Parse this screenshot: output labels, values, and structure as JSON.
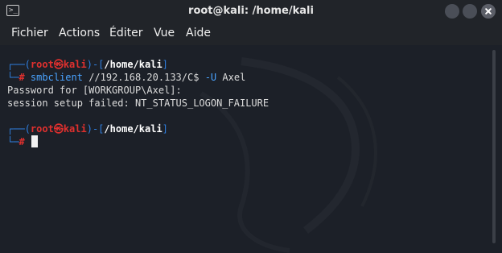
{
  "window": {
    "title": "root@kali: /home/kali",
    "app_icon_glyph": ">_"
  },
  "menu": [
    "Fichier",
    "Actions",
    "Éditer",
    "Vue",
    "Aide"
  ],
  "terminal": {
    "prompt1": {
      "box_top": "┌──(",
      "user": "root",
      "skull": "㉿",
      "host": "kali",
      "sep": ")-[",
      "path": "/home/kali",
      "close": "]",
      "box_bottom": "└─",
      "hash": "#"
    },
    "command": {
      "program": "smbclient",
      "target": "//192.168.20.133/C$",
      "option": "-U",
      "user": "Axel"
    },
    "output": [
      "Password for [WORKGROUP\\Axel]:",
      "session setup failed: NT_STATUS_LOGON_FAILURE"
    ],
    "prompt2": {
      "box_top": "┌──(",
      "user": "root",
      "skull": "㉿",
      "host": "kali",
      "sep": ")-[",
      "path": "/home/kali",
      "close": "]",
      "box_bottom": "└─",
      "hash": "#"
    }
  },
  "colors": {
    "background": "#1c2028",
    "titlebar": "#212429",
    "prompt_frame": "#2f7fe0",
    "prompt_user": "#e0302e",
    "command": "#4aa3ff"
  }
}
